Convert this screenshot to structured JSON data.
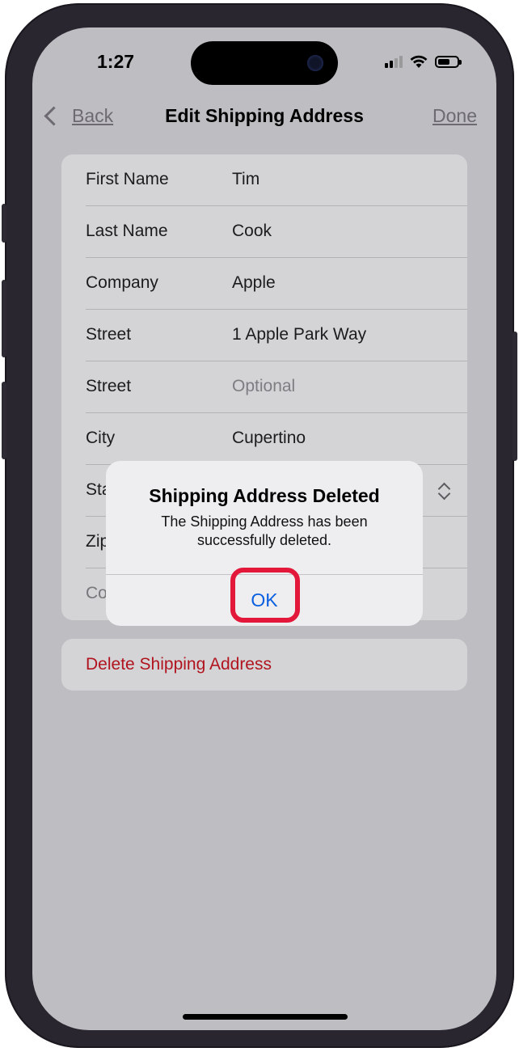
{
  "status_bar": {
    "time": "1:27"
  },
  "nav": {
    "back_label": "Back",
    "title": "Edit Shipping Address",
    "done_label": "Done"
  },
  "form": {
    "rows": [
      {
        "label": "First Name",
        "value": "Tim"
      },
      {
        "label": "Last Name",
        "value": "Cook"
      },
      {
        "label": "Company",
        "value": "Apple"
      },
      {
        "label": "Street",
        "value": "1 Apple Park Way"
      },
      {
        "label": "Street",
        "placeholder": "Optional"
      },
      {
        "label": "City",
        "value": "Cupertino"
      },
      {
        "label_partial": "Sta"
      },
      {
        "label_partial": "Zip"
      },
      {
        "label_partial": "Co"
      }
    ]
  },
  "delete_button": {
    "label": "Delete Shipping Address",
    "color": "#b1141e"
  },
  "alert": {
    "title": "Shipping Address Deleted",
    "message": "The Shipping Address has been successfully deleted.",
    "ok_label": "OK",
    "ok_color": "#0a5fe0",
    "highlight_color": "#e3173a"
  },
  "icons": [
    "chevron-left-icon",
    "cellular-signal-icon",
    "wifi-icon",
    "battery-icon",
    "up-down-chevron-icon"
  ]
}
